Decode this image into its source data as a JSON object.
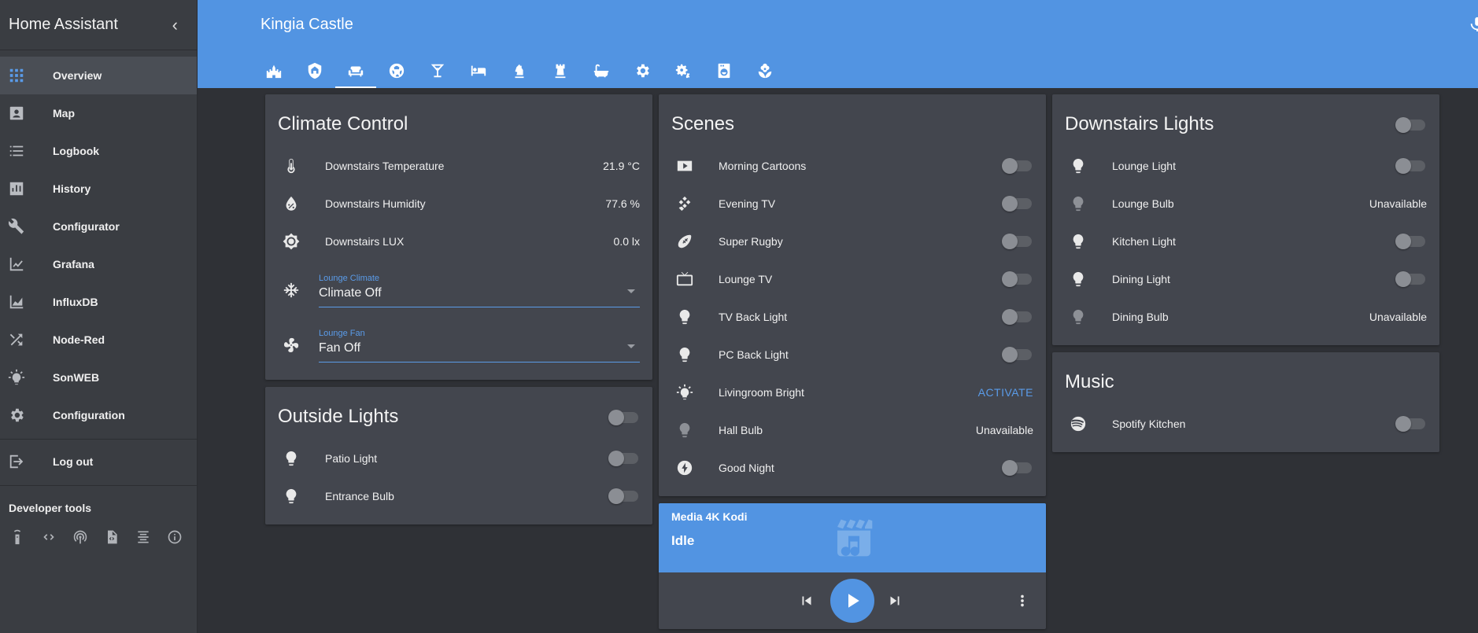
{
  "sidebar": {
    "title": "Home Assistant",
    "collapse_icon": "chevron-left-icon",
    "items": [
      {
        "label": "Overview",
        "icon": "grid-icon",
        "active": true
      },
      {
        "label": "Map",
        "icon": "map-icon"
      },
      {
        "label": "Logbook",
        "icon": "list-icon"
      },
      {
        "label": "History",
        "icon": "chart-icon"
      },
      {
        "label": "Configurator",
        "icon": "wrench-icon"
      },
      {
        "label": "Grafana",
        "icon": "chart-line-icon"
      },
      {
        "label": "InfluxDB",
        "icon": "chart-area-icon"
      },
      {
        "label": "Node-Red",
        "icon": "shuffle-icon"
      },
      {
        "label": "SonWEB",
        "icon": "lightbulb-on-icon"
      },
      {
        "label": "Configuration",
        "icon": "gear-icon"
      }
    ],
    "logout": {
      "label": "Log out",
      "icon": "logout-icon"
    },
    "developer_tools": {
      "title": "Developer tools",
      "icons": [
        "remote-icon",
        "code-icon",
        "broadcast-icon",
        "file-code-icon",
        "scroll-icon",
        "info-icon"
      ]
    }
  },
  "header": {
    "title": "Kingia Castle",
    "tabs": [
      "castle-icon",
      "shield-home-icon",
      "sofa-icon",
      "soccer-icon",
      "cocktail-icon",
      "bed-icon",
      "chess-knight-icon",
      "chess-rook-icon",
      "bathtub-icon",
      "gear-icon",
      "gears-icon",
      "washing-machine-icon",
      "flower-icon"
    ],
    "active_tab": 2
  },
  "climate": {
    "title": "Climate Control",
    "sensors": [
      {
        "label": "Downstairs Temperature",
        "value": "21.9 °C",
        "icon": "thermometer-icon"
      },
      {
        "label": "Downstairs Humidity",
        "value": "77.6 %",
        "icon": "water-percent-icon"
      },
      {
        "label": "Downstairs LUX",
        "value": "0.0 lx",
        "icon": "brightness-icon"
      }
    ],
    "selects": [
      {
        "label": "Lounge Climate",
        "value": "Climate Off",
        "icon": "snowflake-icon"
      },
      {
        "label": "Lounge Fan",
        "value": "Fan Off",
        "icon": "fan-icon"
      }
    ]
  },
  "outside": {
    "title": "Outside Lights",
    "items": [
      {
        "label": "Patio Light",
        "icon": "lightbulb-icon"
      },
      {
        "label": "Entrance Bulb",
        "icon": "lightbulb-icon"
      }
    ]
  },
  "scenes": {
    "title": "Scenes",
    "items": [
      {
        "label": "Morning Cartoons",
        "icon": "youtube-icon"
      },
      {
        "label": "Evening TV",
        "icon": "kodi-icon"
      },
      {
        "label": "Super Rugby",
        "icon": "rugby-icon"
      },
      {
        "label": "Lounge TV",
        "icon": "tv-icon"
      },
      {
        "label": "TV Back Light",
        "icon": "lightbulb-icon"
      },
      {
        "label": "PC Back Light",
        "icon": "lightbulb-icon"
      },
      {
        "label": "Livingroom Bright",
        "icon": "lightbulb-on-icon",
        "action": "ACTIVATE"
      },
      {
        "label": "Hall Bulb",
        "icon": "lightbulb-icon",
        "value": "Unavailable"
      },
      {
        "label": "Good Night",
        "icon": "flash-icon"
      }
    ]
  },
  "media": {
    "name": "Media 4K Kodi",
    "state": "Idle",
    "art_icon": "movie-music-icon"
  },
  "downstairs": {
    "title": "Downstairs Lights",
    "items": [
      {
        "label": "Lounge Light",
        "icon": "lightbulb-icon"
      },
      {
        "label": "Lounge Bulb",
        "icon": "lightbulb-icon",
        "value": "Unavailable"
      },
      {
        "label": "Kitchen Light",
        "icon": "lightbulb-icon"
      },
      {
        "label": "Dining Light",
        "icon": "lightbulb-icon"
      },
      {
        "label": "Dining Bulb",
        "icon": "lightbulb-icon",
        "value": "Unavailable"
      }
    ]
  },
  "music": {
    "title": "Music",
    "items": [
      {
        "label": "Spotify Kitchen",
        "icon": "spotify-icon"
      }
    ]
  },
  "colors": {
    "accent": "#5294e2",
    "background": "#2f3136",
    "card": "#43464e",
    "sidebar": "#3a3d42"
  }
}
